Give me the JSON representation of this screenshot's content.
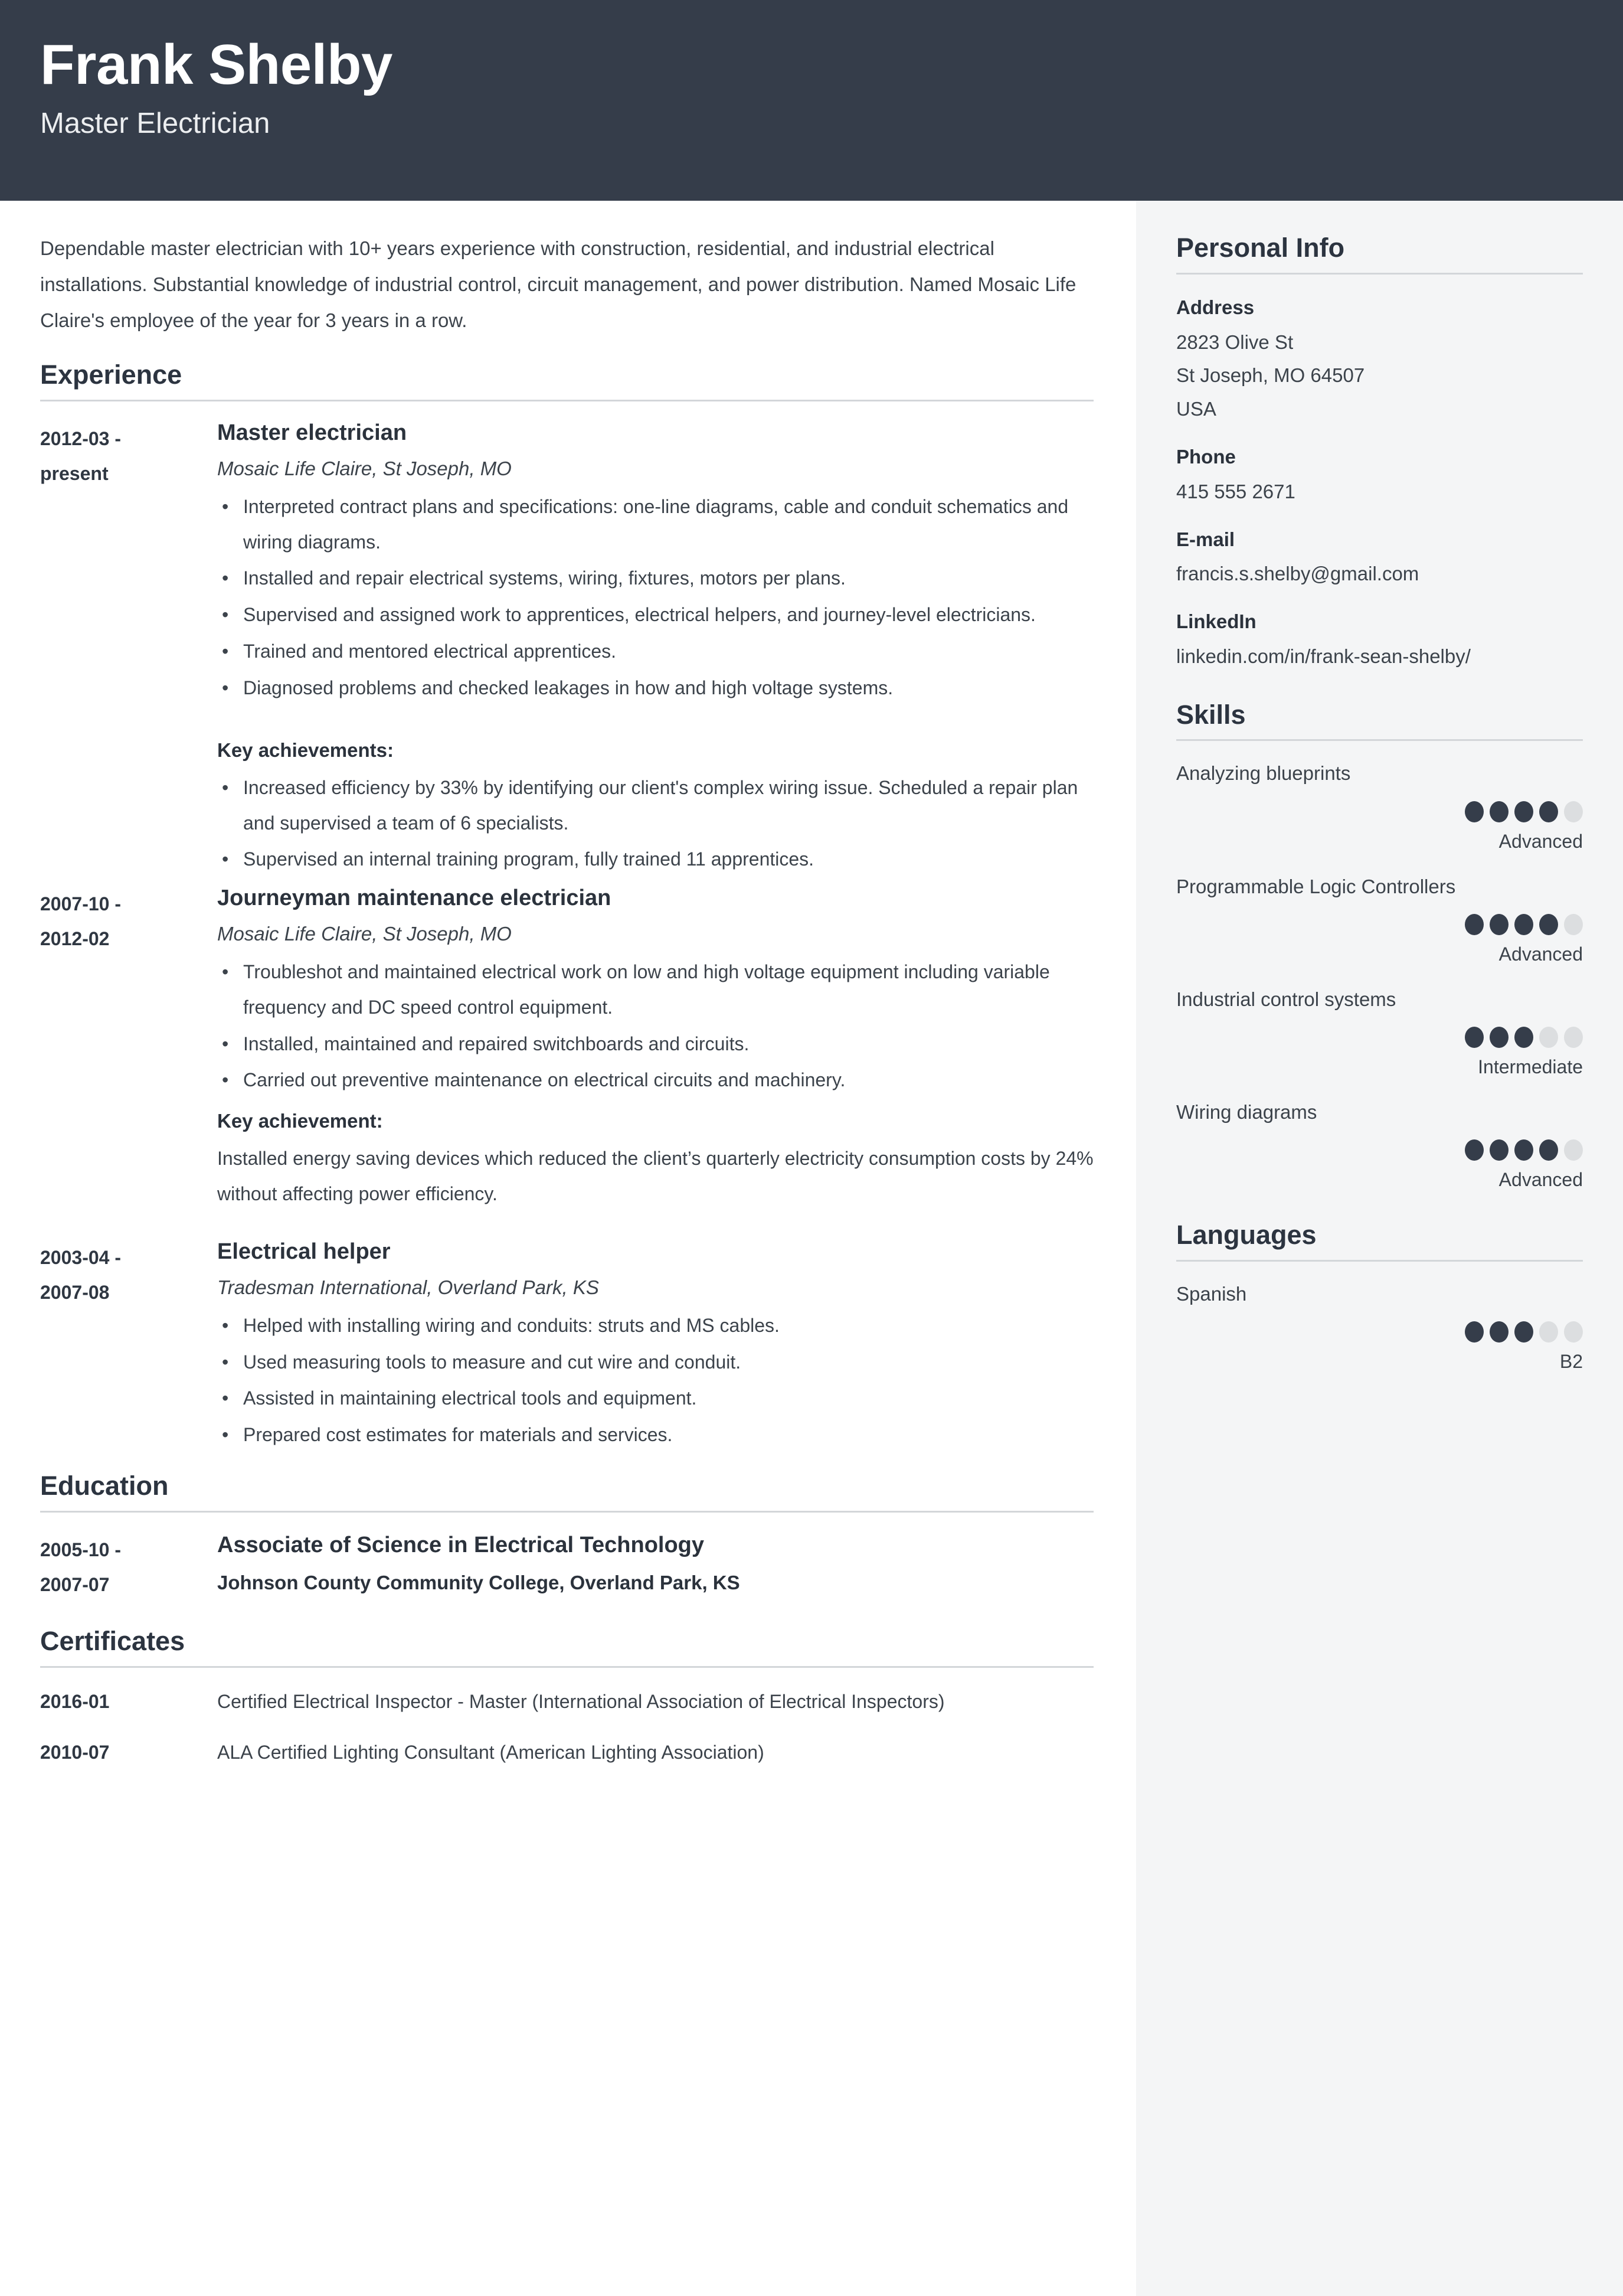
{
  "header": {
    "name": "Frank Shelby",
    "role": "Master Electrician"
  },
  "summary": "Dependable master electrician with 10+ years experience with construction, residential, and industrial electrical installations. Substantial knowledge of industrial control, circuit management, and power distribution. Named Mosaic Life Claire's employee of the year for 3 years in a row.",
  "sections": {
    "experience_title": "Experience",
    "education_title": "Education",
    "certificates_title": "Certificates"
  },
  "experience": [
    {
      "date_from": "2012-03 -",
      "date_to": "present",
      "title": "Master electrician",
      "company": "Mosaic Life Claire, St Joseph, MO",
      "bullets": [
        "Interpreted contract plans and specifications: one-line diagrams, cable and conduit schematics and wiring diagrams.",
        "Installed and repair electrical systems, wiring, fixtures, motors per plans.",
        "Supervised and assigned work to apprentices, electrical helpers, and journey-level electricians.",
        "Trained and mentored electrical apprentices.",
        "Diagnosed problems and checked leakages in how and high voltage systems."
      ],
      "achievements_heading": "Key achievements:",
      "achievement_bullets": [
        "Increased efficiency by 33% by identifying our client's complex wiring issue. Scheduled a repair plan and supervised a team of 6 specialists.",
        "Supervised an internal training program, fully trained 11 apprentices."
      ]
    },
    {
      "date_from": "2007-10 -",
      "date_to": "2012-02",
      "title": "Journeyman maintenance electrician",
      "company": "Mosaic Life Claire, St Joseph, MO",
      "bullets": [
        "Troubleshot and maintained electrical work on low and high voltage equipment including variable frequency and DC speed control equipment.",
        "Installed, maintained and repaired switchboards and circuits.",
        "Carried out preventive maintenance on electrical circuits and machinery."
      ],
      "achievements_heading": "Key achievement:",
      "achievement_text": "Installed energy saving devices which reduced the client’s quarterly electricity consumption costs by 24% without affecting power efficiency."
    },
    {
      "date_from": "2003-04 -",
      "date_to": "2007-08",
      "title": "Electrical helper",
      "company": "Tradesman International, Overland Park, KS",
      "bullets": [
        "Helped with installing wiring and conduits: struts and MS cables.",
        "Used measuring tools to measure and cut wire and conduit.",
        "Assisted in maintaining electrical tools and equipment.",
        "Prepared cost estimates for materials and services."
      ]
    }
  ],
  "education": [
    {
      "date_from": "2005-10 -",
      "date_to": "2007-07",
      "degree": "Associate of Science in Electrical Technology",
      "school": "Johnson County Community College, Overland Park, KS"
    }
  ],
  "certificates": [
    {
      "date": "2016-01",
      "text": "Certified Electrical Inspector - Master (International Association of Electrical Inspectors)"
    },
    {
      "date": "2010-07",
      "text": "ALA Certified Lighting Consultant (American Lighting Association)"
    }
  ],
  "sidebar": {
    "personal_info_title": "Personal Info",
    "skills_title": "Skills",
    "languages_title": "Languages",
    "contact": {
      "address_label": "Address",
      "address_line1": "2823 Olive St",
      "address_line2": "St Joseph, MO 64507",
      "address_line3": "USA",
      "phone_label": "Phone",
      "phone_value": "415 555 2671",
      "email_label": "E-mail",
      "email_value": "francis.s.shelby@gmail.com",
      "linkedin_label": "LinkedIn",
      "linkedin_value": "linkedin.com/in/frank-sean-shelby/"
    },
    "skills": [
      {
        "name": "Analyzing blueprints",
        "filled": 4,
        "total": 5,
        "level": "Advanced"
      },
      {
        "name": "Programmable Logic Controllers",
        "filled": 4,
        "total": 5,
        "level": "Advanced"
      },
      {
        "name": "Industrial control systems",
        "filled": 3,
        "total": 5,
        "level": "Intermediate"
      },
      {
        "name": "Wiring diagrams",
        "filled": 4,
        "total": 5,
        "level": "Advanced"
      }
    ],
    "languages": [
      {
        "name": "Spanish",
        "filled": 3,
        "total": 5,
        "level": "B2"
      }
    ]
  },
  "colors": {
    "header_bg": "#353d4a",
    "sidebar_bg": "#f4f5f6",
    "text": "#3c434b",
    "heading": "#2c3440",
    "dot_on": "#353d4a",
    "dot_off": "#dcdee0",
    "rule": "#d3d6d9"
  }
}
